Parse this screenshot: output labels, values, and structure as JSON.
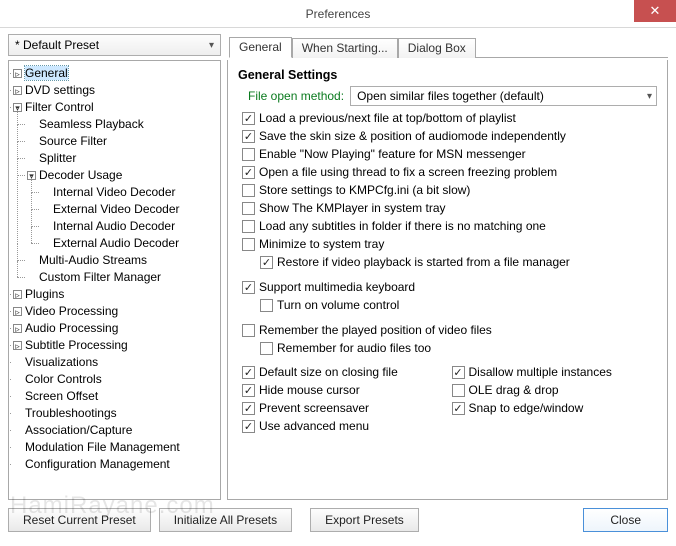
{
  "window": {
    "title": "Preferences"
  },
  "preset": {
    "selected": "* Default Preset"
  },
  "tabs": [
    {
      "label": "General",
      "active": true
    },
    {
      "label": "When Starting...",
      "active": false
    },
    {
      "label": "Dialog Box",
      "active": false
    }
  ],
  "tree": [
    {
      "label": "General",
      "expand": "▹"
    },
    {
      "label": "DVD settings",
      "expand": "▹"
    },
    {
      "label": "Filter Control",
      "expand": "▾",
      "children": [
        {
          "label": "Seamless Playback"
        },
        {
          "label": "Source Filter"
        },
        {
          "label": "Splitter"
        },
        {
          "label": "Decoder Usage",
          "expand": "▾",
          "children": [
            {
              "label": "Internal Video Decoder"
            },
            {
              "label": "External Video Decoder"
            },
            {
              "label": "Internal Audio Decoder"
            },
            {
              "label": "External Audio Decoder"
            }
          ]
        },
        {
          "label": "Multi-Audio Streams"
        },
        {
          "label": "Custom Filter Manager"
        }
      ]
    },
    {
      "label": "Plugins",
      "expand": "▹"
    },
    {
      "label": "Video Processing",
      "expand": "▹"
    },
    {
      "label": "Audio Processing",
      "expand": "▹"
    },
    {
      "label": "Subtitle Processing",
      "expand": "▹"
    },
    {
      "label": "Visualizations"
    },
    {
      "label": "Color Controls"
    },
    {
      "label": "Screen Offset"
    },
    {
      "label": "Troubleshootings"
    },
    {
      "label": "Association/Capture"
    },
    {
      "label": "Modulation File Management"
    },
    {
      "label": "Configuration Management"
    }
  ],
  "general": {
    "section_title": "General Settings",
    "file_open_label": "File open method:",
    "file_open_value": "Open similar files together (default)",
    "checks": {
      "load_prev_next": {
        "label": "Load a previous/next file at top/bottom of playlist",
        "checked": true
      },
      "save_skin": {
        "label": "Save the skin size & position of audiomode independently",
        "checked": true
      },
      "enable_now_playing": {
        "label": "Enable \"Now Playing\" feature for MSN messenger",
        "checked": false
      },
      "open_thread": {
        "label": "Open a file using thread to fix a screen freezing problem",
        "checked": true
      },
      "store_settings": {
        "label": "Store settings to KMPCfg.ini (a bit slow)",
        "checked": false
      },
      "show_tray": {
        "label": "Show The KMPlayer in system tray",
        "checked": false
      },
      "load_subs": {
        "label": "Load any subtitles in folder if there is no matching one",
        "checked": false
      },
      "minimize_tray": {
        "label": "Minimize to system tray",
        "checked": false
      },
      "restore_playback": {
        "label": "Restore if video playback is started from a file manager",
        "checked": true
      },
      "mm_keyboard": {
        "label": "Support multimedia keyboard",
        "checked": true
      },
      "volume_control": {
        "label": "Turn on volume control",
        "checked": false
      },
      "remember_pos": {
        "label": "Remember the played position of video files",
        "checked": false
      },
      "remember_audio": {
        "label": "Remember for audio files too",
        "checked": false
      },
      "default_size": {
        "label": "Default size on closing file",
        "checked": true
      },
      "hide_cursor": {
        "label": "Hide mouse cursor",
        "checked": true
      },
      "prevent_screensaver": {
        "label": "Prevent screensaver",
        "checked": true
      },
      "advanced_menu": {
        "label": "Use advanced menu",
        "checked": true
      },
      "disallow_multi": {
        "label": "Disallow multiple instances",
        "checked": true
      },
      "ole_drag": {
        "label": "OLE drag & drop",
        "checked": false
      },
      "snap_edge": {
        "label": "Snap to edge/window",
        "checked": true
      }
    }
  },
  "buttons": {
    "reset": "Reset Current Preset",
    "init_all": "Initialize All Presets",
    "export": "Export Presets",
    "close": "Close"
  },
  "watermark": "HamiRayane.com"
}
